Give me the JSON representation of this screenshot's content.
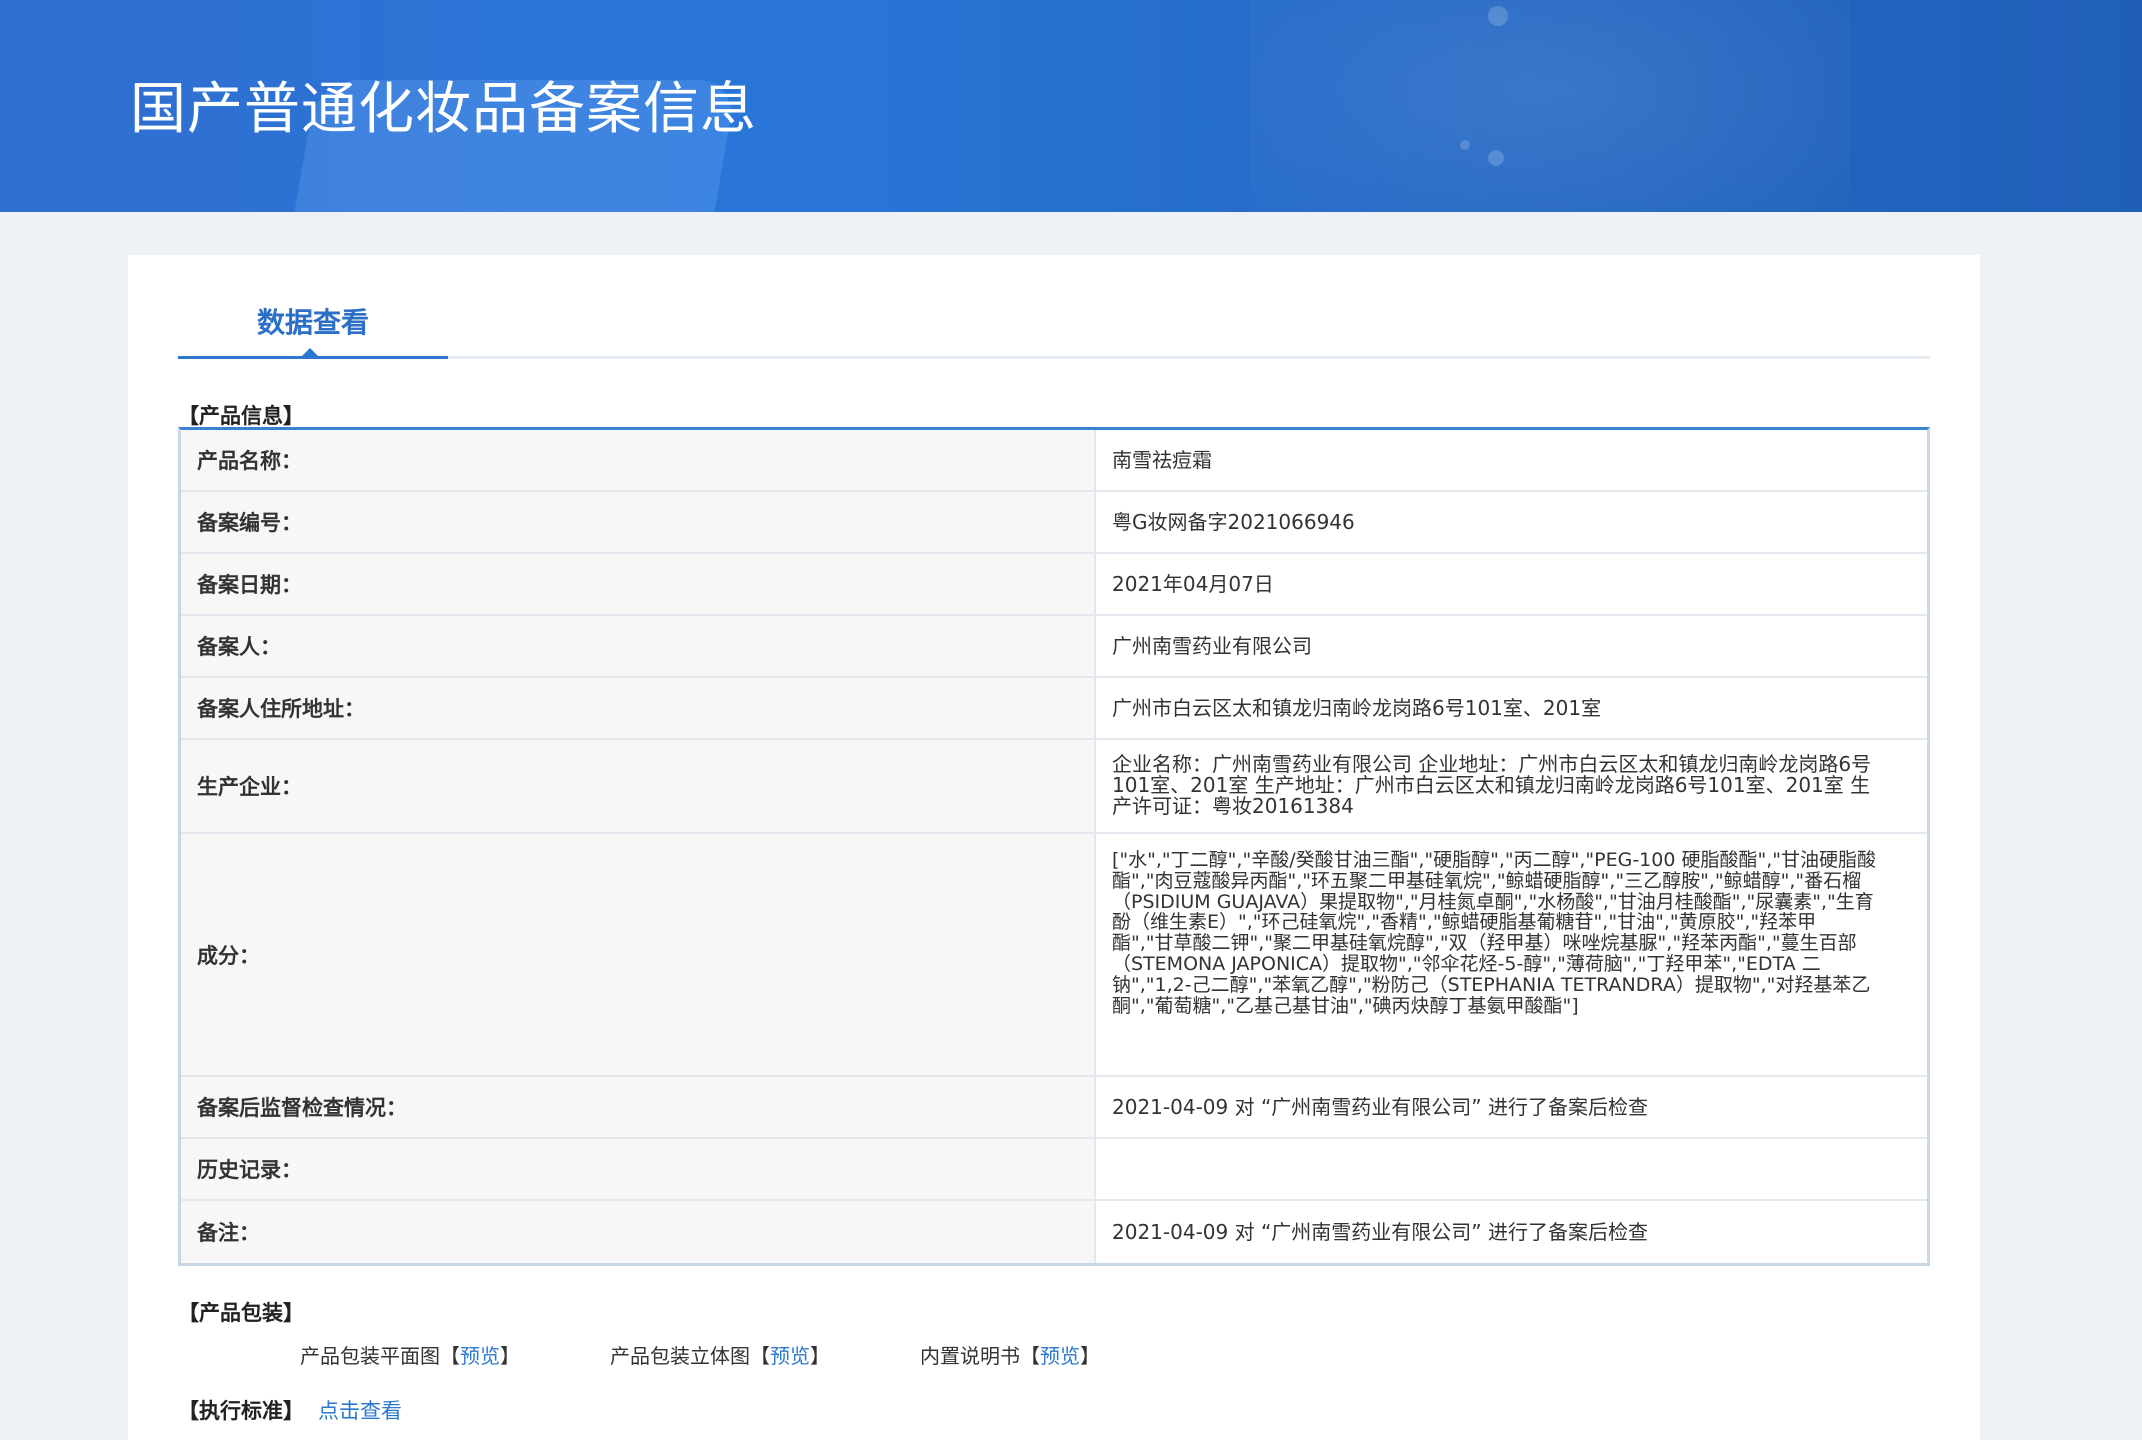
{
  "banner": {
    "title": "国产普通化妆品备案信息"
  },
  "tabs": [
    {
      "label": "数据查看",
      "active": true
    }
  ],
  "sections": {
    "product_info": "【产品信息】",
    "packaging": "【产品包装】",
    "standard": "【执行标准】"
  },
  "table": {
    "rows": [
      {
        "label": "产品名称：",
        "value": "南雪祛痘霜"
      },
      {
        "label": "备案编号：",
        "value": "粤G妆网备字2021066946"
      },
      {
        "label": "备案日期：",
        "value": "2021年04月07日"
      },
      {
        "label": "备案人：",
        "value": "广州南雪药业有限公司"
      },
      {
        "label": "备案人住所地址：",
        "value": "广州市白云区太和镇龙归南岭龙岗路6号101室、201室"
      },
      {
        "label": "生产企业：",
        "value": "企业名称：广州南雪药业有限公司 企业地址：广州市白云区太和镇龙归南岭龙岗路6号101室、201室 生产地址：广州市白云区太和镇龙归南岭龙岗路6号101室、201室 生产许可证：粤妆20161384"
      },
      {
        "label": "成分：",
        "value": "[\"水\",\"丁二醇\",\"辛酸/癸酸甘油三酯\",\"硬脂醇\",\"丙二醇\",\"PEG-100 硬脂酸酯\",\"甘油硬脂酸酯\",\"肉豆蔻酸异丙酯\",\"环五聚二甲基硅氧烷\",\"鲸蜡硬脂醇\",\"三乙醇胺\",\"鲸蜡醇\",\"番石榴（PSIDIUM GUAJAVA）果提取物\",\"月桂氮卓酮\",\"水杨酸\",\"甘油月桂酸酯\",\"尿囊素\",\"生育酚（维生素E）\",\"环己硅氧烷\",\"香精\",\"鲸蜡硬脂基葡糖苷\",\"甘油\",\"黄原胶\",\"羟苯甲酯\",\"甘草酸二钾\",\"聚二甲基硅氧烷醇\",\"双（羟甲基）咪唑烷基脲\",\"羟苯丙酯\",\"蔓生百部（STEMONA JAPONICA）提取物\",\"邻伞花烃-5-醇\",\"薄荷脑\",\"丁羟甲苯\",\"EDTA 二钠\",\"1,2-己二醇\",\"苯氧乙醇\",\"粉防己（STEPHANIA TETRANDRA）提取物\",\"对羟基苯乙酮\",\"葡萄糖\",\"乙基己基甘油\",\"碘丙炔醇丁基氨甲酸酯\"]"
      },
      {
        "label": "备案后监督检查情况：",
        "value": "2021-04-09 对 “广州南雪药业有限公司” 进行了备案后检查"
      },
      {
        "label": "历史记录：",
        "value": ""
      },
      {
        "label": "备注：",
        "value": "2021-04-09 对 “广州南雪药业有限公司” 进行了备案后检查"
      }
    ]
  },
  "packaging": {
    "items": [
      {
        "label": "产品包装平面图",
        "open": "【",
        "link": "预览",
        "close": "】"
      },
      {
        "label": "产品包装立体图",
        "open": "【",
        "link": "预览",
        "close": "】"
      },
      {
        "label": "内置说明书",
        "open": "【",
        "link": "预览",
        "close": "】"
      }
    ]
  },
  "standard_link": "点击查看",
  "colors": {
    "banner": "#2a76d8",
    "accent": "#2b78d0",
    "label_bg": "#f7f7f7"
  }
}
